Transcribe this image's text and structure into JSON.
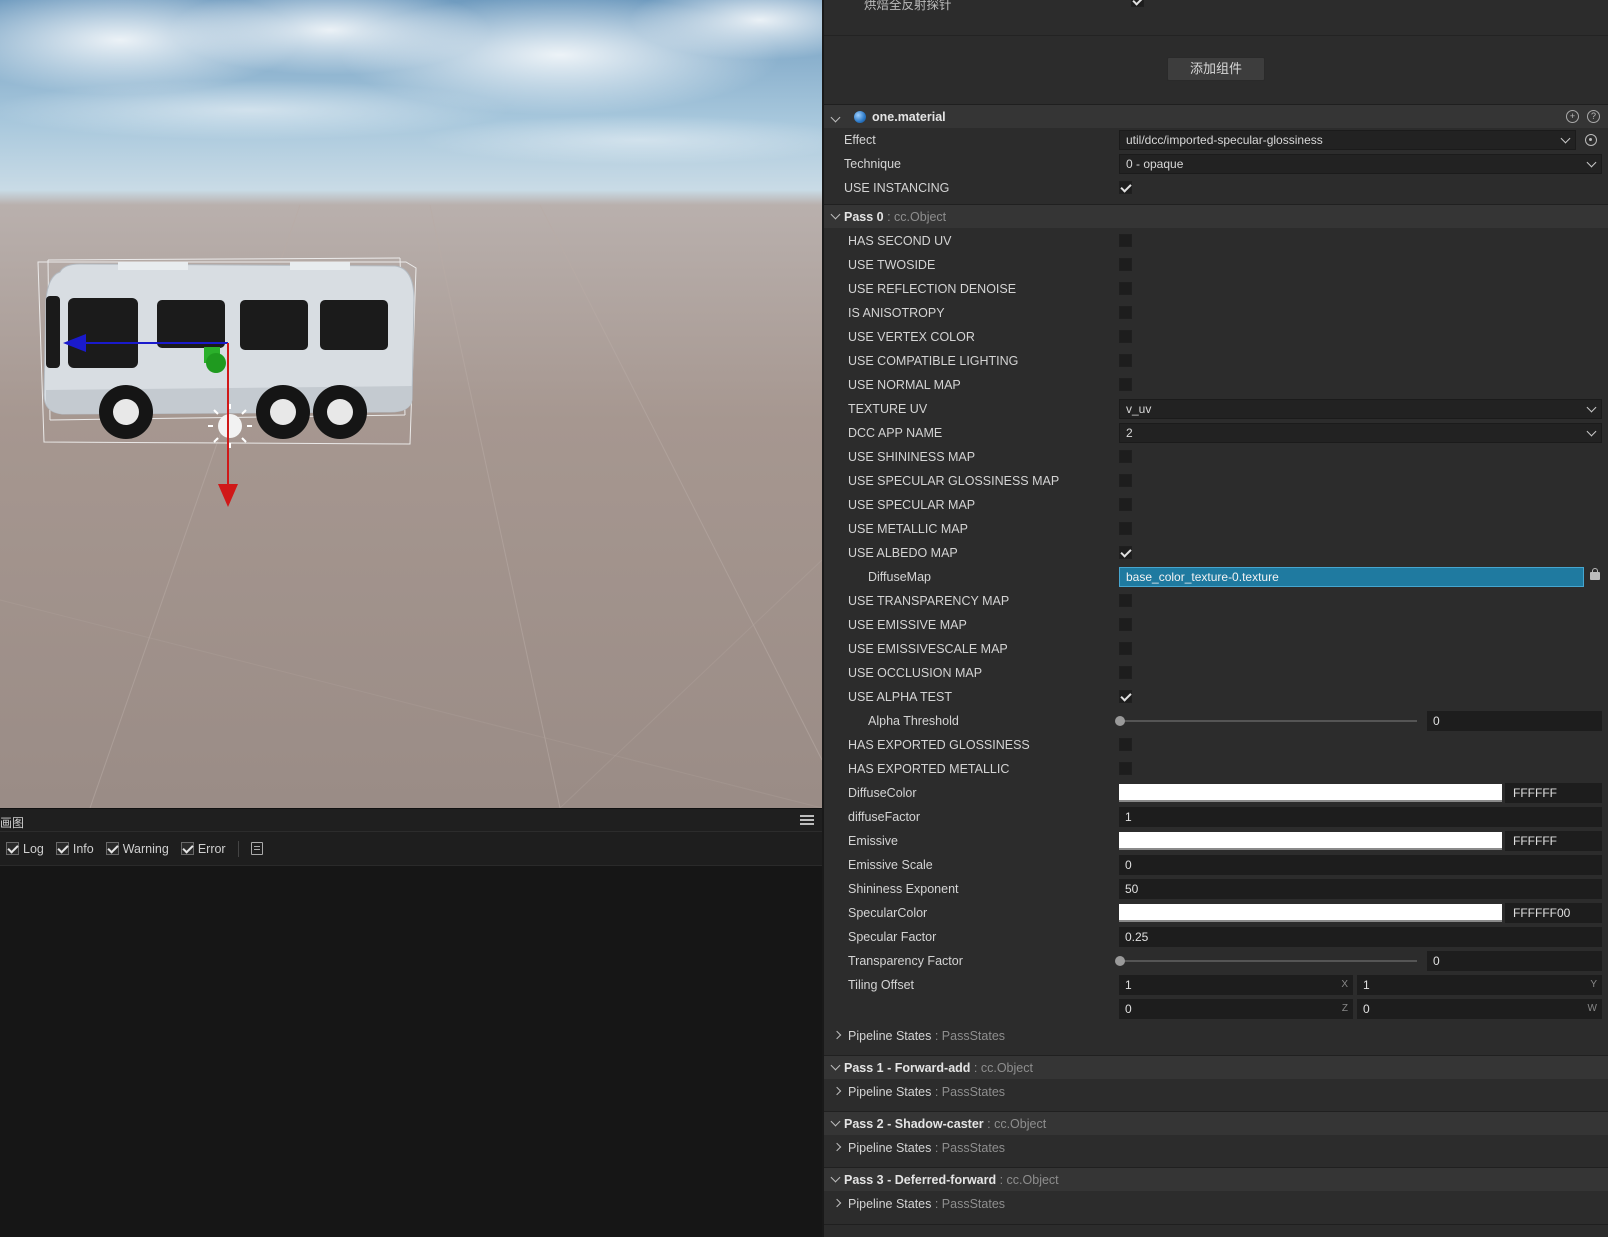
{
  "console": {
    "tab_label": "画图",
    "filters": [
      {
        "label": "Log",
        "checked": true
      },
      {
        "label": "Info",
        "checked": true
      },
      {
        "label": "Warning",
        "checked": true
      },
      {
        "label": "Error",
        "checked": true
      }
    ]
  },
  "inspector": {
    "top_label": "烘焙全反射探针",
    "add_component_label": "添加组件",
    "component_title": "one.material",
    "effect": {
      "label": "Effect",
      "value": "util/dcc/imported-specular-glossiness"
    },
    "technique": {
      "label": "Technique",
      "value": "0 - opaque"
    },
    "use_instancing": {
      "label": "USE INSTANCING",
      "checked": true
    },
    "pass0": {
      "name": "Pass 0",
      "type": " : cc.Object"
    },
    "defines": [
      {
        "label": "HAS SECOND UV",
        "checked": false
      },
      {
        "label": "USE TWOSIDE",
        "checked": false
      },
      {
        "label": "USE REFLECTION DENOISE",
        "checked": false
      },
      {
        "label": "IS ANISOTROPY",
        "checked": false
      },
      {
        "label": "USE VERTEX COLOR",
        "checked": false
      },
      {
        "label": "USE COMPATIBLE LIGHTING",
        "checked": false
      },
      {
        "label": "USE NORMAL MAP",
        "checked": false
      }
    ],
    "texture_uv": {
      "label": "TEXTURE UV",
      "value": "v_uv"
    },
    "dcc_app_name": {
      "label": "DCC APP NAME",
      "value": "2"
    },
    "maps": [
      {
        "label": "USE SHININESS MAP",
        "checked": false
      },
      {
        "label": "USE SPECULAR GLOSSINESS MAP",
        "checked": false
      },
      {
        "label": "USE SPECULAR MAP",
        "checked": false
      },
      {
        "label": "USE METALLIC MAP",
        "checked": false
      },
      {
        "label": "USE ALBEDO MAP",
        "checked": true
      }
    ],
    "diffuse_map": {
      "label": "DiffuseMap",
      "value": "base_color_texture-0.texture"
    },
    "maps2": [
      {
        "label": "USE TRANSPARENCY MAP",
        "checked": false
      },
      {
        "label": "USE EMISSIVE MAP",
        "checked": false
      },
      {
        "label": "USE EMISSIVESCALE MAP",
        "checked": false
      },
      {
        "label": "USE OCCLUSION MAP",
        "checked": false
      },
      {
        "label": "USE ALPHA TEST",
        "checked": true
      }
    ],
    "alpha_threshold": {
      "label": "Alpha Threshold",
      "value": "0",
      "level": 0
    },
    "exported": [
      {
        "label": "HAS EXPORTED GLOSSINESS",
        "checked": false
      },
      {
        "label": "HAS EXPORTED METALLIC",
        "checked": false
      }
    ],
    "diffuse_color": {
      "label": "DiffuseColor",
      "hex": "FFFFFF",
      "color": "#ffffff"
    },
    "diffuse_factor": {
      "label": "diffuseFactor",
      "value": "1"
    },
    "emissive": {
      "label": "Emissive",
      "hex": "FFFFFF",
      "color": "#ffffff"
    },
    "emissive_scale": {
      "label": "Emissive Scale",
      "value": "0"
    },
    "shininess_exponent": {
      "label": "Shininess Exponent",
      "value": "50"
    },
    "specular_color": {
      "label": "SpecularColor",
      "hex": "FFFFFF00",
      "color": "#ffffff"
    },
    "specular_factor": {
      "label": "Specular Factor",
      "value": "0.25"
    },
    "transparency_factor": {
      "label": "Transparency Factor",
      "value": "0",
      "level": 0
    },
    "tiling_offset": {
      "label": "Tiling Offset",
      "x": "1",
      "y": "1",
      "z": "0",
      "w": "0",
      "x_axis": "X",
      "y_axis": "Y",
      "z_axis": "Z",
      "w_axis": "W"
    },
    "pipeline_label": "Pipeline States",
    "pipeline_type": " : PassStates",
    "passes": [
      {
        "name": "Pass 1 - Forward-add",
        "type": " : cc.Object"
      },
      {
        "name": "Pass 2 - Shadow-caster",
        "type": " : cc.Object"
      },
      {
        "name": "Pass 3 - Deferred-forward",
        "type": " : cc.Object"
      }
    ]
  },
  "colors": {
    "accent_asset": "#1f7aa0",
    "gizmo_x": "#d01818",
    "gizmo_z": "#1a1acc",
    "gizmo_y": "#20a020"
  }
}
